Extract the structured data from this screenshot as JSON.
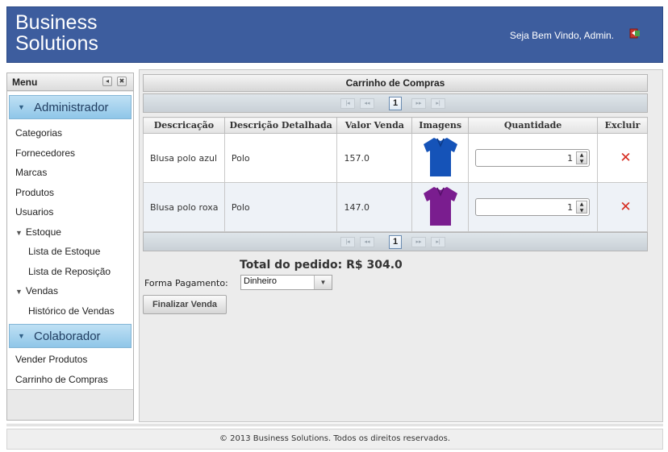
{
  "header": {
    "brand_line1": "Business",
    "brand_line2": "Solutions",
    "welcome": "Seja Bem Vindo, Admin.",
    "logout_icon": "logout-icon",
    "bg_color": "#3d5d9e"
  },
  "sidebar": {
    "title": "Menu",
    "sections": [
      {
        "label": "Administrador",
        "items": [
          "Categorias",
          "Fornecedores",
          "Marcas",
          "Produtos",
          "Usuarios"
        ],
        "groups": [
          {
            "label": "Estoque",
            "items": [
              "Lista de Estoque",
              "Lista de Reposição"
            ]
          },
          {
            "label": "Vendas",
            "items": [
              "Histórico de Vendas"
            ]
          }
        ]
      },
      {
        "label": "Colaborador",
        "items": [
          "Vender Produtos",
          "Carrinho de Compras"
        ]
      }
    ]
  },
  "cart": {
    "title": "Carrinho de Compras",
    "page": "1",
    "columns": [
      "Descricação",
      "Descrição Detalhada",
      "Valor Venda",
      "Imagens",
      "Quantidade",
      "Excluir"
    ],
    "rows": [
      {
        "descricao": "Blusa polo azul",
        "detalhe": "Polo",
        "valor": "157.0",
        "image_color": "#1553b8",
        "quantidade": "1"
      },
      {
        "descricao": "Blusa polo roxa",
        "detalhe": "Polo",
        "valor": "147.0",
        "image_color": "#7a1d8f",
        "quantidade": "1"
      }
    ],
    "total": "Total do pedido: R$ 304.0",
    "payment_label": "Forma Pagamento:",
    "payment_value": "Dinheiro",
    "finalize": "Finalizar Venda"
  },
  "footer": {
    "text": "© 2013 Business Solutions. Todos os direitos reservados."
  }
}
